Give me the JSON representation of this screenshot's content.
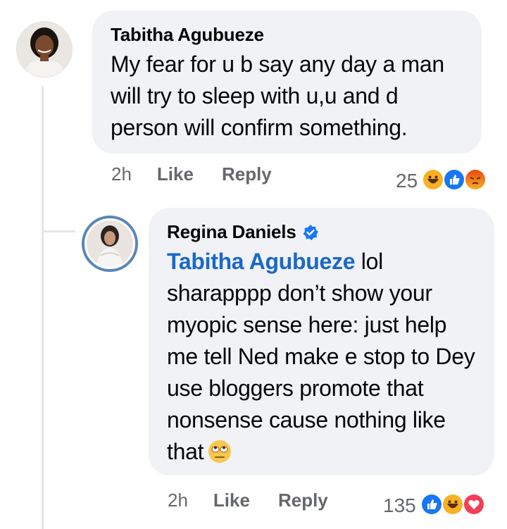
{
  "comment": {
    "author": "Tabitha Agubueze",
    "text": "My fear for u b say any day a man will try to sleep with u,u and d person will confirm something.",
    "time": "2h",
    "like_label": "Like",
    "reply_label": "Reply",
    "reaction_count": "25",
    "reactions": [
      "haha-icon",
      "like-icon",
      "angry-icon"
    ]
  },
  "reply": {
    "author": "Regina Daniels",
    "mention": "Tabitha Agubueze",
    "text": " lol sharapppp don’t show your myopic sense here: just help me tell Ned make e stop to Dey use bloggers promote that nonsense cause nothing like that",
    "time": "2h",
    "like_label": "Like",
    "reply_label": "Reply",
    "reaction_count": "135",
    "reactions": [
      "like-icon",
      "haha-icon",
      "love-icon"
    ]
  },
  "colors": {
    "bubble": "#f0f2f5",
    "mention": "#1b68c8",
    "meta": "#65676b",
    "like": "#1877f2",
    "haha": "#f7b125",
    "angry": "#e9710f",
    "love": "#f33e58"
  }
}
